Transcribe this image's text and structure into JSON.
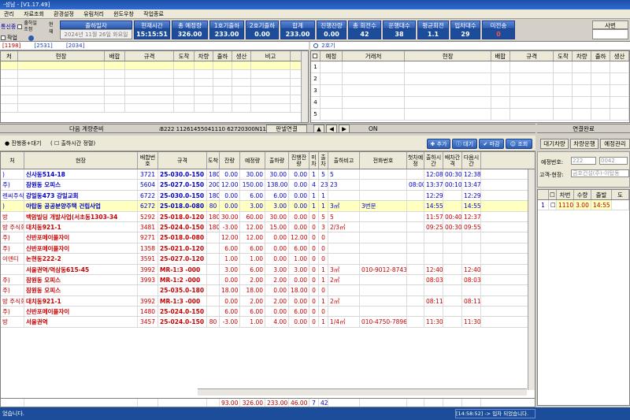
{
  "window": {
    "title": "-성남 - [V1.17.49]"
  },
  "menu": [
    "관리",
    "자료조회",
    "환경설정",
    "유림처리",
    "윈도우창",
    "작업종료"
  ],
  "top_checks": {
    "label1": "출하",
    "label2": "출하일 조정",
    "label3": "현재",
    "sub": "작업",
    "badge": "통신중",
    "radio": "환성"
  },
  "date": {
    "header": "출하일자",
    "value": "2024년 11월 26일 화요일"
  },
  "stats": [
    {
      "h": "현재시간",
      "v": "15:15:51"
    },
    {
      "h": "총 예정량",
      "v": "326.00"
    },
    {
      "h": "1호기출하",
      "v": "233.00"
    },
    {
      "h": "2호기출하",
      "v": "0.00"
    },
    {
      "h": "합계",
      "v": "233.00"
    },
    {
      "h": "진행잔량",
      "v": "0.00"
    },
    {
      "h": "총 회전수",
      "v": "42"
    },
    {
      "h": "운행대수",
      "v": "38"
    },
    {
      "h": "평균회전",
      "v": "1.1"
    },
    {
      "h": "입차대수",
      "v": "29"
    },
    {
      "h": "미전송",
      "v": "0"
    }
  ],
  "top_right": {
    "label": "사번"
  },
  "codes": [
    "[1198]",
    "[2531]",
    "[2034]"
  ],
  "left_grid": {
    "headers": [
      "처",
      "현장",
      "배합",
      "규격",
      "도착",
      "차량",
      "출하",
      "생산",
      "비고"
    ]
  },
  "right_grid": {
    "title": "2호기",
    "headers": [
      "",
      "예정",
      "거래처",
      "현장",
      "배합",
      "규격",
      "도착",
      "차량",
      "출하",
      "생산"
    ],
    "rows": [
      "1",
      "2",
      "3",
      "4",
      "5"
    ]
  },
  "midbar": {
    "label": "다음 계량준비",
    "code": "ᵢB222 11261455041110  62720300N11ᵢ",
    "btn_manual": "판넬연결",
    "on": "ON",
    "right": "연결완료"
  },
  "filter": {
    "radio1": "진행중+대기",
    "radio2": "출하시간 정렬",
    "buttons": [
      "추가",
      "대기",
      "마감",
      "조회"
    ]
  },
  "main": {
    "headers": [
      "처",
      "현장",
      "배합번호",
      "규격",
      "도착",
      "잔량",
      "예정량",
      "출하량",
      "진행잔량",
      "미차",
      "출차",
      "출하비고",
      "전화번호",
      "첫차예정",
      "출하시간",
      "배차간격",
      "다음시간"
    ],
    "rows": [
      {
        "c": ")",
        "site": "신사동514-18",
        "mix": "3721",
        "spec": "25-030.0-150",
        "arr": "180",
        "rem": "0.00",
        "plan": "30.00",
        "ship": "30.00",
        "prog": "0.00",
        "mi": "1",
        "out": "5",
        "note": "5",
        "tel": "",
        "first": "",
        "time": "12:08",
        "gap": "00:30",
        "next": "12:38",
        "color": "#0000c8",
        "sel": false
      },
      {
        "c": "주)",
        "site": "잠원동 오피스",
        "mix": "5604",
        "spec": "25-027.0-150",
        "arr": "200",
        "rem": "12.00",
        "plan": "150.00",
        "ship": "138.00",
        "prog": "0.00",
        "mi": "4",
        "out": "23",
        "note": "23",
        "tel": "",
        "first": "08:00",
        "time": "13:37",
        "gap": "00:10",
        "next": "13:47",
        "color": "#0000c8",
        "sel": false
      },
      {
        "c": "렌씨주식회",
        "site": "강일동473 강일교회",
        "mix": "6722",
        "spec": "25-030.0-150",
        "arr": "180",
        "rem": "0.00",
        "plan": "6.00",
        "ship": "6.00",
        "prog": "0.00",
        "mi": "1",
        "out": "1",
        "note": "",
        "tel": "",
        "first": "",
        "time": "12:29",
        "gap": "",
        "next": "12:29",
        "color": "#0000c8",
        "sel": false
      },
      {
        "c": ")",
        "site": "아탑동 공공분양주택 건립사업",
        "mix": "6272",
        "spec": "25-018.0-080",
        "arr": "80",
        "rem": "0.00",
        "plan": "3.00",
        "ship": "3.00",
        "prog": "0.00",
        "mi": "1",
        "out": "1",
        "note": "3㎥",
        "tel": "3번문",
        "first": "",
        "time": "14:55",
        "gap": "",
        "next": "14:55",
        "color": "#0000c8",
        "sel": true
      },
      {
        "c": "방",
        "site": "백암빌딩 개발사업(서초동1303-34",
        "mix": "5292",
        "spec": "25-018.0-120",
        "arr": "180",
        "rem": "30.00",
        "plan": "60.00",
        "ship": "30.00",
        "prog": "0.00",
        "mi": "0",
        "out": "5",
        "note": "5",
        "tel": "",
        "first": "",
        "time": "11:57",
        "gap": "00:40",
        "next": "12:37",
        "color": "#c80000",
        "sel": false
      },
      {
        "c": "방 주식회",
        "site": "대치동921-1",
        "mix": "3481",
        "spec": "25-024.0-150",
        "arr": "180",
        "rem": "-3.00",
        "plan": "12.00",
        "ship": "15.00",
        "prog": "0.00",
        "mi": "0",
        "out": "3",
        "note": "2/3㎥",
        "tel": "",
        "first": "",
        "time": "09:25",
        "gap": "00:30",
        "next": "09:55",
        "color": "#c80000",
        "sel": false
      },
      {
        "c": "주)",
        "site": "신반포메이플자이",
        "mix": "9271",
        "spec": "25-018.0-080",
        "arr": "",
        "rem": "12.00",
        "plan": "12.00",
        "ship": "0.00",
        "prog": "12.00",
        "mi": "0",
        "out": "0",
        "note": "",
        "tel": "",
        "first": "",
        "time": "",
        "gap": "",
        "next": "",
        "color": "#c80000",
        "sel": false
      },
      {
        "c": "주)",
        "site": "신반포메이플자이",
        "mix": "1358",
        "spec": "25-021.0-120",
        "arr": "",
        "rem": "6.00",
        "plan": "6.00",
        "ship": "0.00",
        "prog": "6.00",
        "mi": "0",
        "out": "0",
        "note": "",
        "tel": "",
        "first": "",
        "time": "",
        "gap": "",
        "next": "",
        "color": "#c80000",
        "sel": false
      },
      {
        "c": "이앤티",
        "site": "논현동222-2",
        "mix": "3591",
        "spec": "25-027.0-120",
        "arr": "",
        "rem": "1.00",
        "plan": "1.00",
        "ship": "0.00",
        "prog": "1.00",
        "mi": "0",
        "out": "0",
        "note": "",
        "tel": "",
        "first": "",
        "time": "",
        "gap": "",
        "next": "",
        "color": "#c80000",
        "sel": false
      },
      {
        "c": "",
        "site": "서울권역/역삼동615-45",
        "mix": "3992",
        "spec": "MR-1:3  -000",
        "arr": "",
        "rem": "3.00",
        "plan": "6.00",
        "ship": "3.00",
        "prog": "3.00",
        "mi": "0",
        "out": "1",
        "note": "3㎥",
        "tel": "010-9012-8743",
        "first": "",
        "time": "12:40",
        "gap": "",
        "next": "12:40",
        "color": "#c80000",
        "sel": false
      },
      {
        "c": "주)",
        "site": "잠원동 오피스",
        "mix": "3993",
        "spec": "MR-1:2  -000",
        "arr": "",
        "rem": "0.00",
        "plan": "2.00",
        "ship": "2.00",
        "prog": "0.00",
        "mi": "0",
        "out": "1",
        "note": "2㎥",
        "tel": "",
        "first": "",
        "time": "08:03",
        "gap": "",
        "next": "08:03",
        "color": "#c80000",
        "sel": false
      },
      {
        "c": "주)",
        "site": "잠원동 오피스",
        "mix": "",
        "spec": "25-035.0-180",
        "arr": "",
        "rem": "18.00",
        "plan": "18.00",
        "ship": "0.00",
        "prog": "18.00",
        "mi": "0",
        "out": "0",
        "note": "",
        "tel": "",
        "first": "",
        "time": "",
        "gap": "",
        "next": "",
        "color": "#c80000",
        "sel": false
      },
      {
        "c": "방 주식회",
        "site": "대치동921-1",
        "mix": "3992",
        "spec": "MR-1:3  -000",
        "arr": "",
        "rem": "0.00",
        "plan": "2.00",
        "ship": "2.00",
        "prog": "0.00",
        "mi": "0",
        "out": "1",
        "note": "2㎥",
        "tel": "",
        "first": "",
        "time": "08:11",
        "gap": "",
        "next": "08:11",
        "color": "#c80000",
        "sel": false
      },
      {
        "c": "주)",
        "site": "신반포메이플자이",
        "mix": "1480",
        "spec": "25-024.0-150",
        "arr": "",
        "rem": "6.00",
        "plan": "6.00",
        "ship": "0.00",
        "prog": "6.00",
        "mi": "0",
        "out": "0",
        "note": "",
        "tel": "",
        "first": "",
        "time": "",
        "gap": "",
        "next": "",
        "color": "#c80000",
        "sel": false
      },
      {
        "c": "방",
        "site": "서울권역",
        "mix": "3457",
        "spec": "25-024.0-150",
        "arr": "80",
        "rem": "-3.00",
        "plan": "1.00",
        "ship": "4.00",
        "prog": "0.00",
        "mi": "0",
        "out": "1",
        "note": "1/4㎥",
        "tel": "010-4750-7896",
        "first": "",
        "time": "11:30",
        "gap": "",
        "next": "11:30",
        "color": "#c80000",
        "sel": false
      }
    ],
    "totals": {
      "rem": "93.00",
      "plan": "326.00",
      "ship": "233.00",
      "prog": "46.00",
      "mi": "7",
      "out": "42"
    }
  },
  "right_panel": {
    "tabs": [
      "대기차량",
      "차량운행",
      "예정관리"
    ],
    "plan_label": "예정번호:",
    "plan_v1": "222",
    "plan_v2": "0042",
    "cust_label": "고객-현장:",
    "cust_value": "금호건설(주)-아탑동",
    "headers": [
      "",
      "차번",
      "수량",
      "출발",
      "도"
    ],
    "rows": [
      {
        "no": "1",
        "car": "1110",
        "qty": "3.00",
        "dep": "14:55"
      }
    ]
  },
  "status": {
    "left": "었습니다.",
    "right": "[14:58:52] -> 입차 되었습니다."
  }
}
